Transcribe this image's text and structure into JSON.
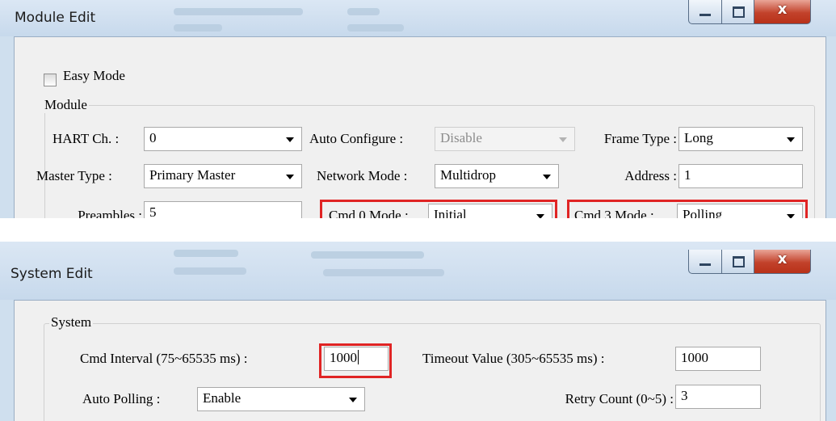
{
  "module_window": {
    "title": "Module Edit",
    "easy_mode": {
      "label": "Easy Mode",
      "checked": false
    },
    "group_label": "Module",
    "hart_ch": {
      "label": "HART Ch. :",
      "value": "0"
    },
    "auto_configure": {
      "label": "Auto Configure :",
      "value": "Disable",
      "disabled": true
    },
    "frame_type": {
      "label": "Frame Type :",
      "value": "Long"
    },
    "master_type": {
      "label": "Master Type :",
      "value": "Primary Master"
    },
    "network_mode": {
      "label": "Network Mode :",
      "value": "Multidrop"
    },
    "address": {
      "label": "Address :",
      "value": "1"
    },
    "preambles": {
      "label": "Preambles :",
      "value": "5"
    },
    "cmd0_mode": {
      "label": "Cmd 0 Mode :",
      "value": "Initial"
    },
    "cmd3_mode": {
      "label": "Cmd 3 Mode :",
      "value": "Polling"
    }
  },
  "system_window": {
    "title": "System Edit",
    "group_label": "System",
    "cmd_interval": {
      "label": "Cmd Interval (75~65535 ms) :",
      "value": "1000"
    },
    "timeout_value": {
      "label": "Timeout Value (305~65535 ms) :",
      "value": "1000"
    },
    "auto_polling": {
      "label": "Auto Polling :",
      "value": "Enable"
    },
    "retry_count": {
      "label": "Retry Count (0~5) :",
      "value": "3"
    }
  },
  "colors": {
    "highlight": "#e02424",
    "titlebar": "#cfdfee",
    "close_button": "#c2422b"
  }
}
